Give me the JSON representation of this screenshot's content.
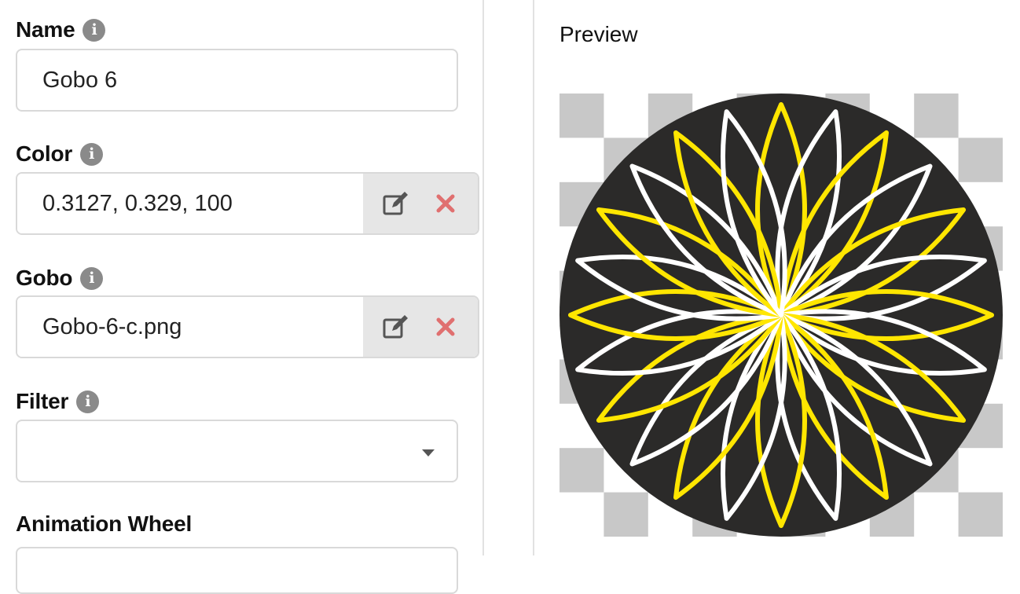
{
  "form": {
    "name": {
      "label": "Name",
      "value": "Gobo 6"
    },
    "color": {
      "label": "Color",
      "value": "0.3127, 0.329, 100"
    },
    "gobo": {
      "label": "Gobo",
      "value": "Gobo-6-c.png"
    },
    "filter": {
      "label": "Filter",
      "value": ""
    },
    "animation_wheel": {
      "label": "Animation Wheel"
    }
  },
  "icons": {
    "info": "info-icon",
    "edit": "edit-icon",
    "clear": "clear-icon",
    "dropdown": "chevron-down-icon"
  },
  "preview": {
    "label": "Preview"
  },
  "colors": {
    "gobo_background": "#2b2a29",
    "petal_yellow": "#ffe600",
    "petal_white": "#ffffff",
    "checker": "#c8c8c8",
    "clear_red": "#e07070",
    "info_gray": "#8a8a8a"
  }
}
